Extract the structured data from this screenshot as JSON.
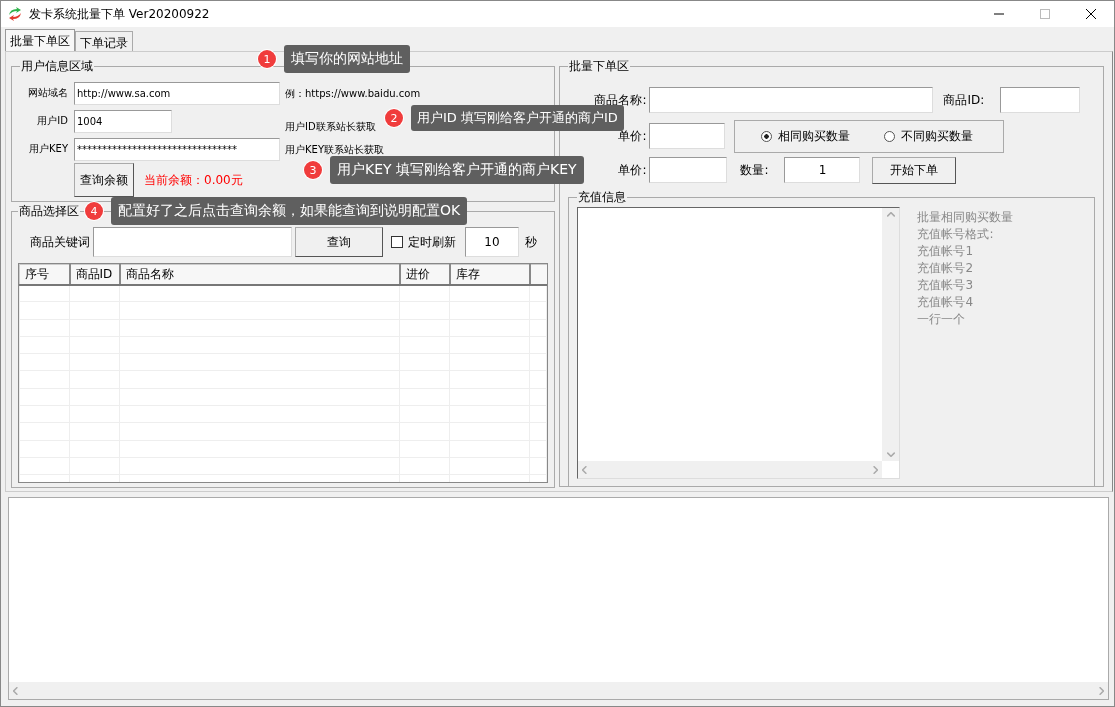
{
  "window": {
    "title": "发卡系统批量下单 Ver20200922"
  },
  "tabs": [
    {
      "label": "批量下单区",
      "selected": true
    },
    {
      "label": "下单记录",
      "selected": false
    }
  ],
  "user_info": {
    "title": "用户信息区域",
    "fields": [
      {
        "label": "网站域名",
        "value": "http://www.sa.com",
        "hint": "例：https://www.baidu.com"
      },
      {
        "label": "用户ID",
        "value": "1004",
        "hint": "用户ID联系站长获取"
      },
      {
        "label": "用户KEY",
        "value": "********************************",
        "hint": "用户KEY联系站长获取"
      }
    ],
    "balance_button": "查询余额",
    "balance": "当前余额：0.00元"
  },
  "goods": {
    "title": "商品选择区",
    "keyword_label": "商品关键词",
    "search_button": "查询",
    "auto_refresh": {
      "label": "定时刷新",
      "checked": false
    },
    "interval": "10",
    "interval_unit": "秒",
    "table": {
      "columns": [
        "序号",
        "商品ID",
        "商品名称",
        "进价",
        "库存"
      ]
    }
  },
  "order": {
    "title": "批量下单区",
    "name_label": "商品名称:",
    "id_label": "商品ID:",
    "price_label": "单价:",
    "mode_options": [
      {
        "label": "相同购买数量",
        "selected": true
      },
      {
        "label": "不同购买数量",
        "selected": false
      }
    ],
    "customer_price_label": "单价:",
    "quantity_label": "数量:",
    "quantity": "1",
    "start_button": "开始下单",
    "recharge": {
      "title": "充值信息",
      "help": [
        "批量相同购买数量",
        "充值帐号格式:",
        "充值帐号1",
        "充值帐号2",
        "充值帐号3",
        "充值帐号4",
        "一行一个"
      ]
    }
  },
  "tooltips": [
    {
      "number": "1",
      "text": "填写你的网站地址"
    },
    {
      "number": "2",
      "text": "用户ID 填写刚给客户开通的商户ID"
    },
    {
      "number": "3",
      "text": "用户KEY 填写刚给客户开通的商户KEY"
    },
    {
      "number": "4",
      "text": "配置好了之后点击查询余额，如果能查询到说明配置OK"
    }
  ]
}
